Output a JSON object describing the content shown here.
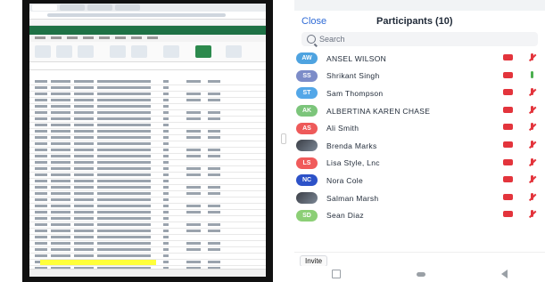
{
  "status_bar": {
    "left": "",
    "right": ""
  },
  "header": {
    "close": "Close",
    "title": "Participants (10)"
  },
  "search": {
    "placeholder": "Search"
  },
  "participants": [
    {
      "initials": "AW",
      "name": "ANSEL WILSON",
      "color": "#4ea3e0",
      "avatar_type": "initials",
      "audio": "muted",
      "video": "off"
    },
    {
      "initials": "SS",
      "name": "Shrikant Singh",
      "color": "#7c8cc8",
      "avatar_type": "initials",
      "audio": "muted",
      "video": "on"
    },
    {
      "initials": "ST",
      "name": "Sam Thompson",
      "color": "#53a7e8",
      "avatar_type": "initials",
      "audio": "muted",
      "video": "off"
    },
    {
      "initials": "AK",
      "name": "ALBERTINA KAREN CHASE",
      "color": "#7cc57b",
      "avatar_type": "initials",
      "audio": "muted",
      "video": "off"
    },
    {
      "initials": "AS",
      "name": "Ali Smith",
      "color": "#ee5a5a",
      "avatar_type": "initials",
      "audio": "muted",
      "video": "off"
    },
    {
      "initials": "",
      "name": "Brenda Marks",
      "color": "#55606e",
      "avatar_type": "photo",
      "audio": "muted",
      "video": "off"
    },
    {
      "initials": "LS",
      "name": "Lisa Style, Lnc",
      "color": "#f05b5b",
      "avatar_type": "initials",
      "audio": "muted",
      "video": "off"
    },
    {
      "initials": "NC",
      "name": "Nora Cole",
      "color": "#2d52c8",
      "avatar_type": "initials",
      "audio": "muted",
      "video": "off"
    },
    {
      "initials": "",
      "name": "Salman Marsh",
      "color": "#5c4aa0",
      "avatar_type": "photo",
      "audio": "muted",
      "video": "off"
    },
    {
      "initials": "SD",
      "name": "Sean Diaz",
      "color": "#8ccf76",
      "avatar_type": "initials",
      "audio": "muted",
      "video": "off"
    }
  ],
  "footer": {
    "invite": "Invite"
  },
  "left_screen": {
    "description": "shared spreadsheet"
  }
}
